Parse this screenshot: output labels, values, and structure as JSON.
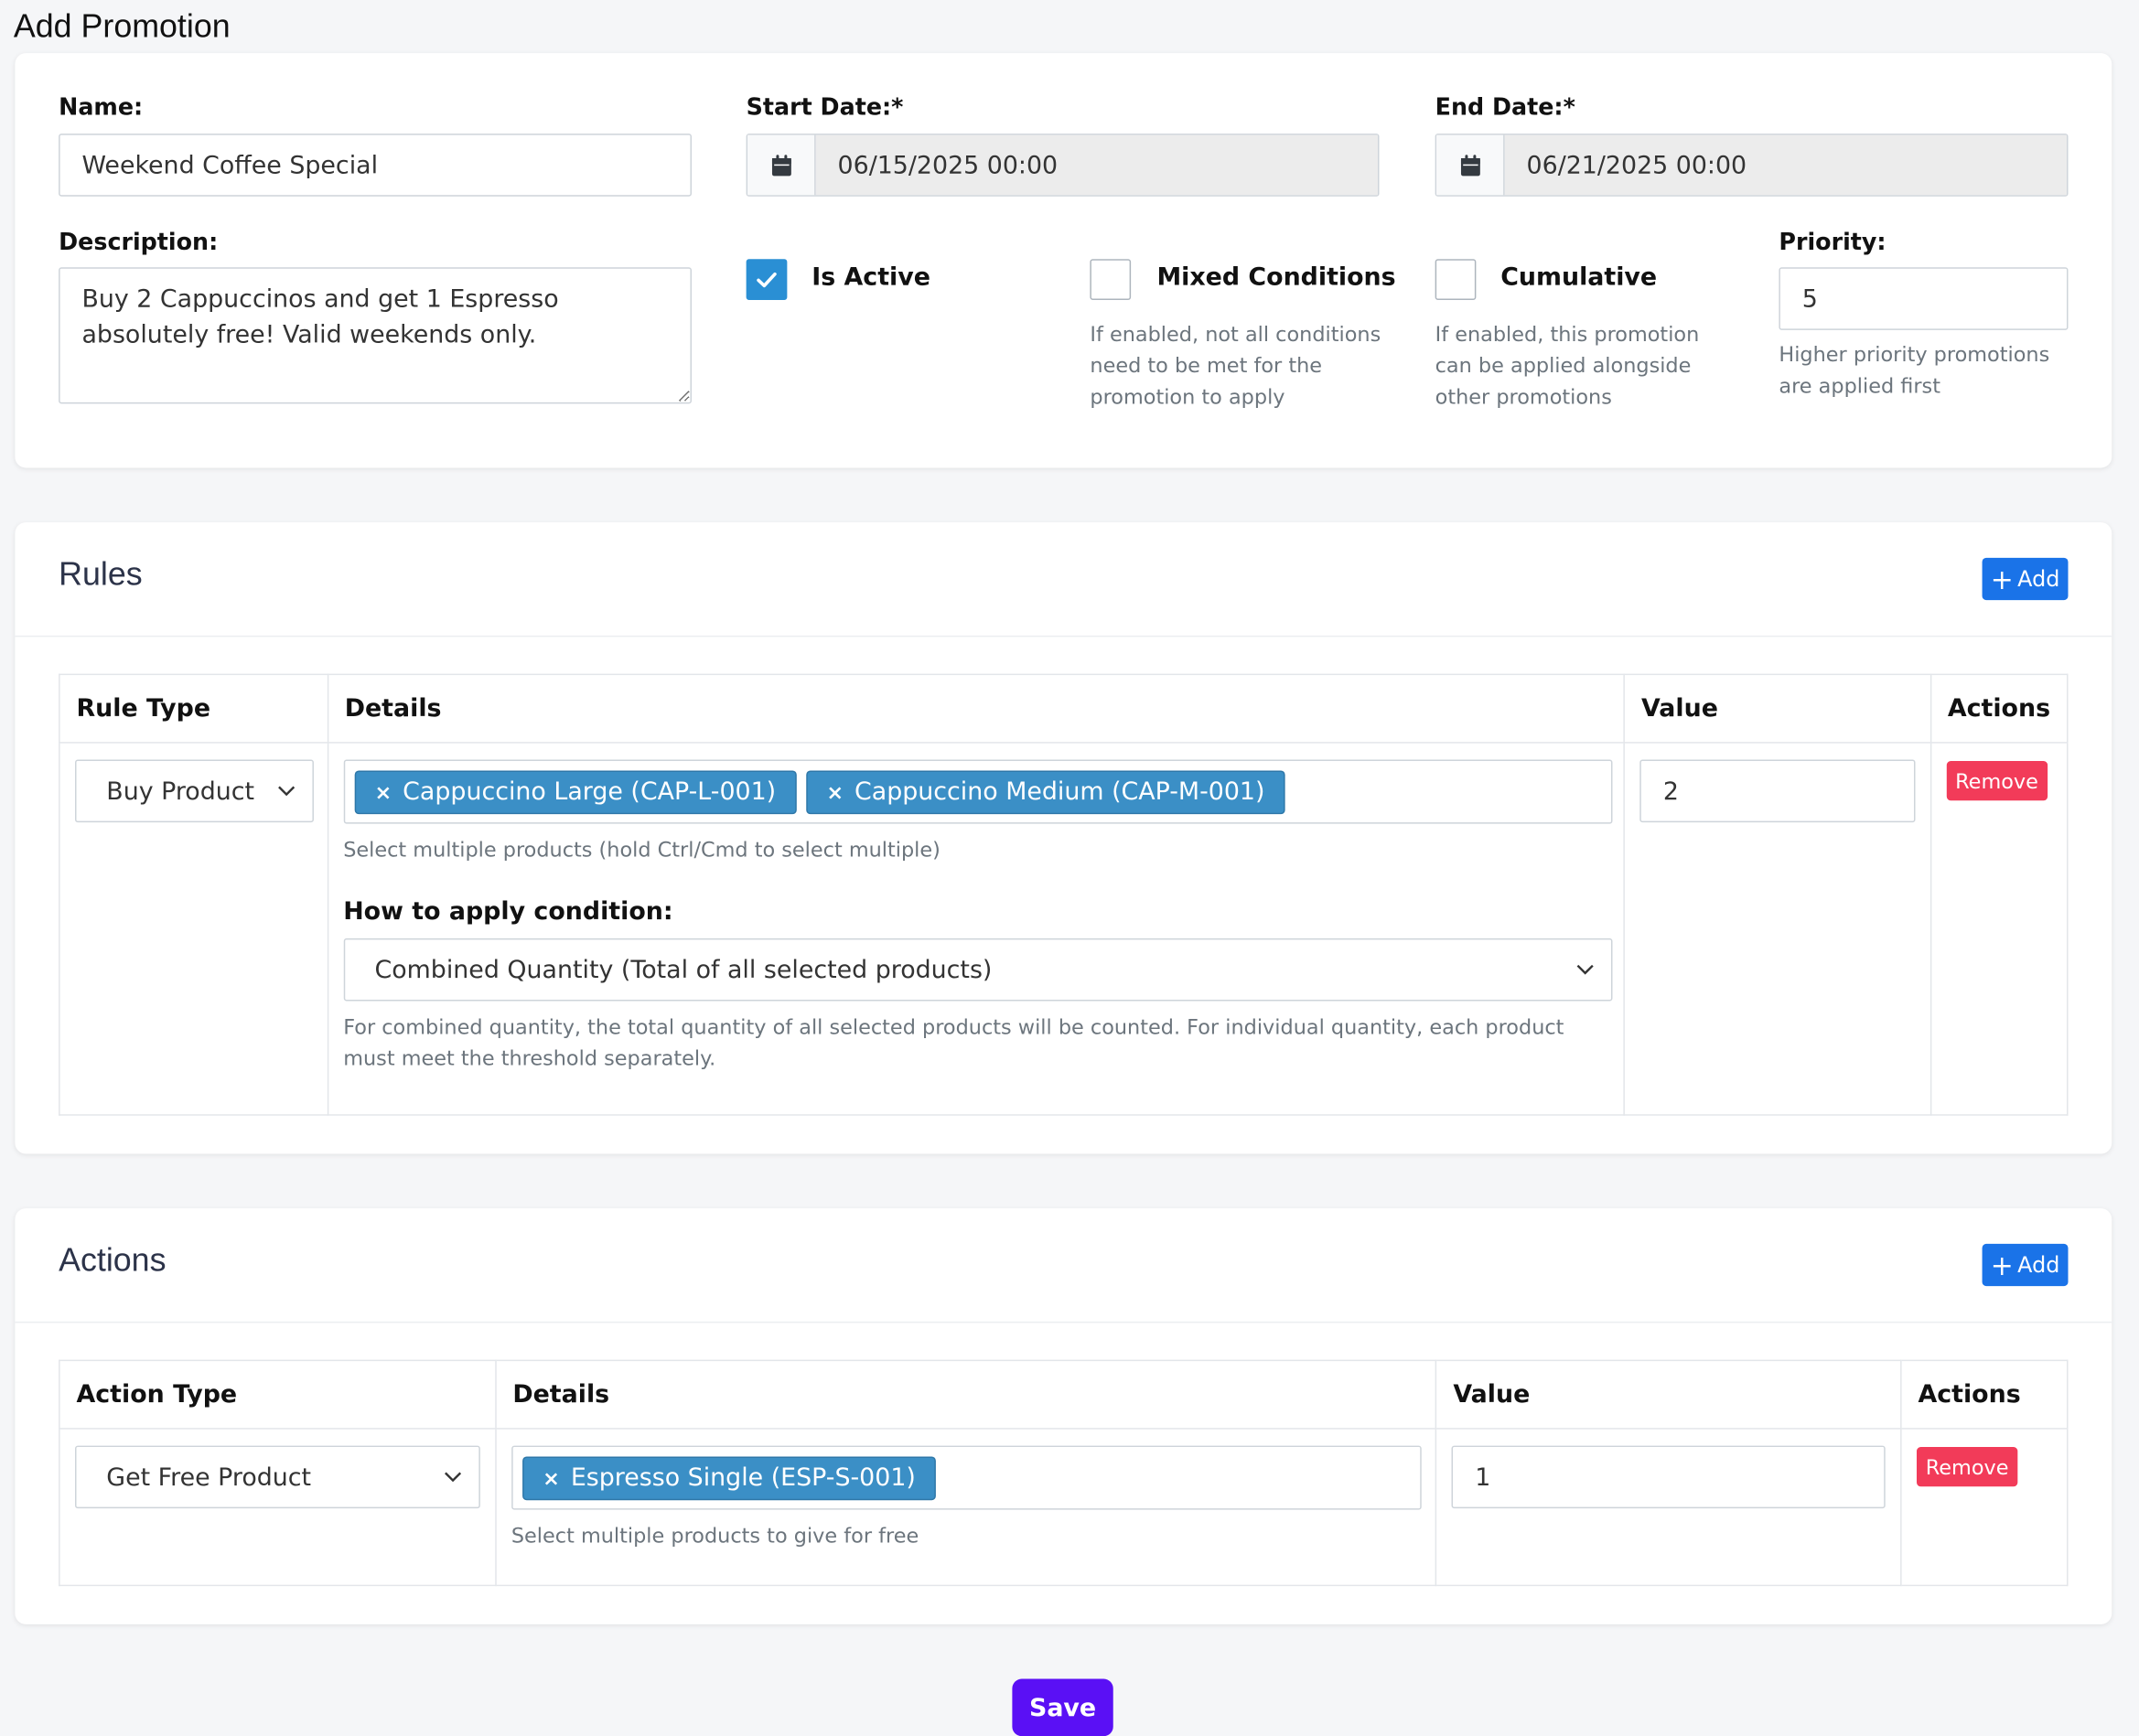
{
  "page": {
    "title": "Add Promotion"
  },
  "general": {
    "name_label": "Name:",
    "name_value": "Weekend Coffee Special",
    "start_label": "Start Date:*",
    "start_value": "06/15/2025 00:00",
    "end_label": "End Date:*",
    "end_value": "06/21/2025 00:00",
    "description_label": "Description:",
    "description_value": "Buy 2 Cappuccinos and get 1 Espresso absolutely free! Valid weekends only.",
    "is_active_label": "Is Active",
    "is_active_checked": true,
    "mixed_label": "Mixed Conditions",
    "mixed_checked": false,
    "mixed_help": "If enabled, not all conditions need to be met for the promotion to apply",
    "cumulative_label": "Cumulative",
    "cumulative_checked": false,
    "cumulative_help": "If enabled, this promotion can be applied alongside other promotions",
    "priority_label": "Priority:",
    "priority_value": "5",
    "priority_help": "Higher priority promotions are applied first"
  },
  "rules": {
    "title": "Rules",
    "add_label": "Add",
    "columns": [
      "Rule Type",
      "Details",
      "Value",
      "Actions"
    ],
    "row": {
      "type": "Buy Product",
      "products": [
        "Cappuccino Large (CAP-L-001)",
        "Cappuccino Medium (CAP-M-001)"
      ],
      "products_help": "Select multiple products (hold Ctrl/Cmd to select multiple)",
      "apply_label": "How to apply condition:",
      "apply_value": "Combined Quantity (Total of all selected products)",
      "apply_help": "For combined quantity, the total quantity of all selected products will be counted. For individual quantity, each product must meet the threshold separately.",
      "value": "2",
      "remove_label": "Remove"
    }
  },
  "actions": {
    "title": "Actions",
    "add_label": "Add",
    "columns": [
      "Action Type",
      "Details",
      "Value",
      "Actions"
    ],
    "row": {
      "type": "Get Free Product",
      "products": [
        "Espresso Single (ESP-S-001)"
      ],
      "products_help": "Select multiple products to give for free",
      "value": "1",
      "remove_label": "Remove"
    }
  },
  "footer": {
    "save_label": "Save"
  },
  "colors": {
    "accent": "#1a73e8",
    "danger": "#f23b59",
    "save": "#5a10f5",
    "tag": "#3b8fc6",
    "checkbox": "#2a8fd4"
  }
}
